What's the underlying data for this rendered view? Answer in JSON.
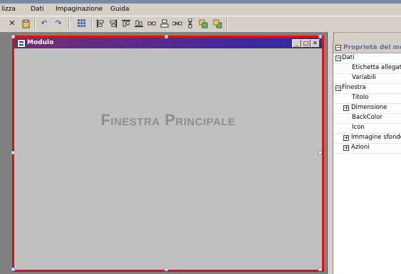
{
  "menu": [
    "lizza",
    "Dati",
    "Impaginazione",
    "Guida"
  ],
  "toolbar_icons": [
    "cut-icon",
    "paste-icon",
    "undo-icon",
    "redo-icon",
    "grid-icon",
    "align-left-icon",
    "align-right-icon",
    "align-top-icon",
    "align-bottom-icon",
    "center-horizontal-icon",
    "center-vertical-icon",
    "same-width-icon",
    "same-height-icon",
    "bring-front-icon",
    "send-back-icon"
  ],
  "form": {
    "title": "Modulo",
    "heading": "Finestra Principale"
  },
  "properties": {
    "title": "Proprietà del mod",
    "items": [
      {
        "label": "Dati",
        "level": 0,
        "toggle": "−"
      },
      {
        "label": "Etichetta allegata",
        "level": 2
      },
      {
        "label": "Variabili",
        "level": 2
      },
      {
        "label": "Finestra",
        "level": 0,
        "toggle": "−"
      },
      {
        "label": "Titolo",
        "level": 2
      },
      {
        "label": "Dimensione",
        "level": 1,
        "toggle": "+"
      },
      {
        "label": "BackColor",
        "level": 2
      },
      {
        "label": "Icon",
        "level": 2
      },
      {
        "label": "Immagine sfondo",
        "level": 1,
        "toggle": "+"
      },
      {
        "label": "Azioni",
        "level": 1,
        "toggle": "+"
      }
    ]
  },
  "colors": {
    "selection_border": "#e01010",
    "titlebar_start": "#73306f",
    "titlebar_end": "#2a2aa8"
  }
}
